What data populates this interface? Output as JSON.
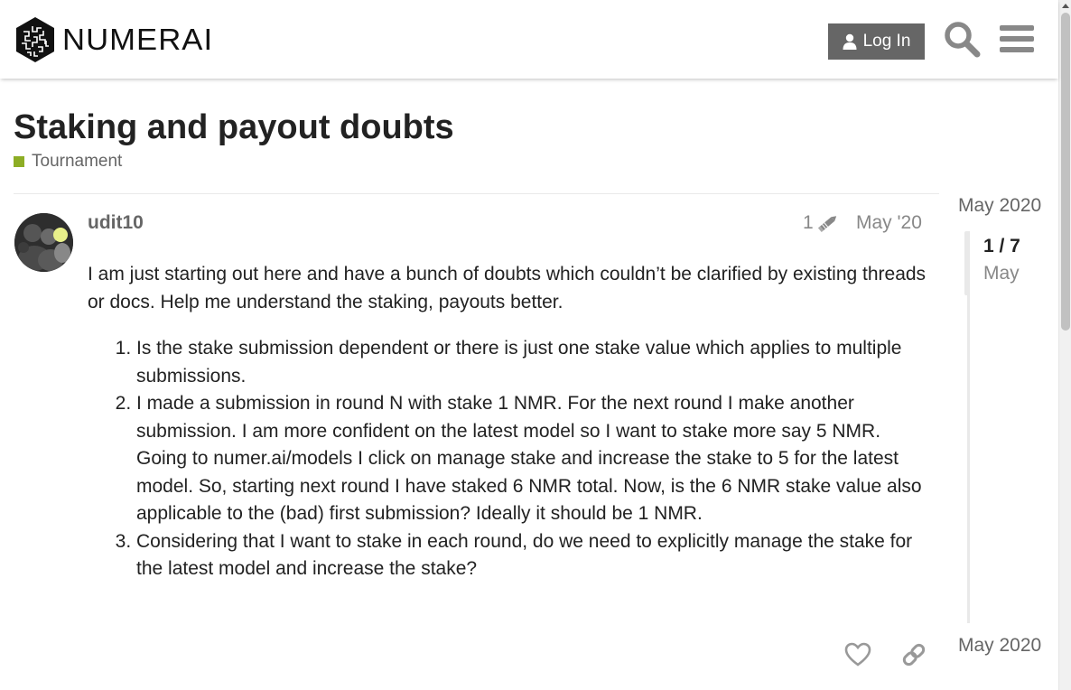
{
  "header": {
    "logo_text": "NUMERAI",
    "login_label": "Log In"
  },
  "topic": {
    "title": "Staking and payout doubts",
    "category": "Tournament",
    "category_color": "#8dad25"
  },
  "post": {
    "username": "udit10",
    "edit_count": "1",
    "date": "May '20",
    "intro": "I am just starting out here and have a bunch of doubts which couldn’t be clarified by existing threads or docs. Help me understand the staking, payouts better.",
    "items": [
      "Is the stake submission dependent or there is just one stake value which applies to multiple submissions.",
      "I made a submission in round N with stake 1 NMR. For the next round I make another submission. I am more confident on the latest model so I want to stake more say 5 NMR. Going to numer.ai/models I click on manage stake and increase the stake to 5 for the latest model. So, starting next round I have staked 6 NMR total. Now, is the 6 NMR stake value also applicable to the (bad) first submission? Ideally it should be 1 NMR.",
      "Considering that I want to stake in each round, do we need to explicitly manage the stake for the latest model and increase the stake?"
    ]
  },
  "timeline": {
    "start_label": "May 2020",
    "position": "1 / 7",
    "position_month": "May",
    "end_label": "May 2020"
  },
  "icons": {
    "search": "search-icon",
    "menu": "hamburger-menu-icon",
    "user": "user-icon",
    "pencil": "pencil-icon",
    "heart": "heart-icon",
    "link": "link-icon"
  }
}
